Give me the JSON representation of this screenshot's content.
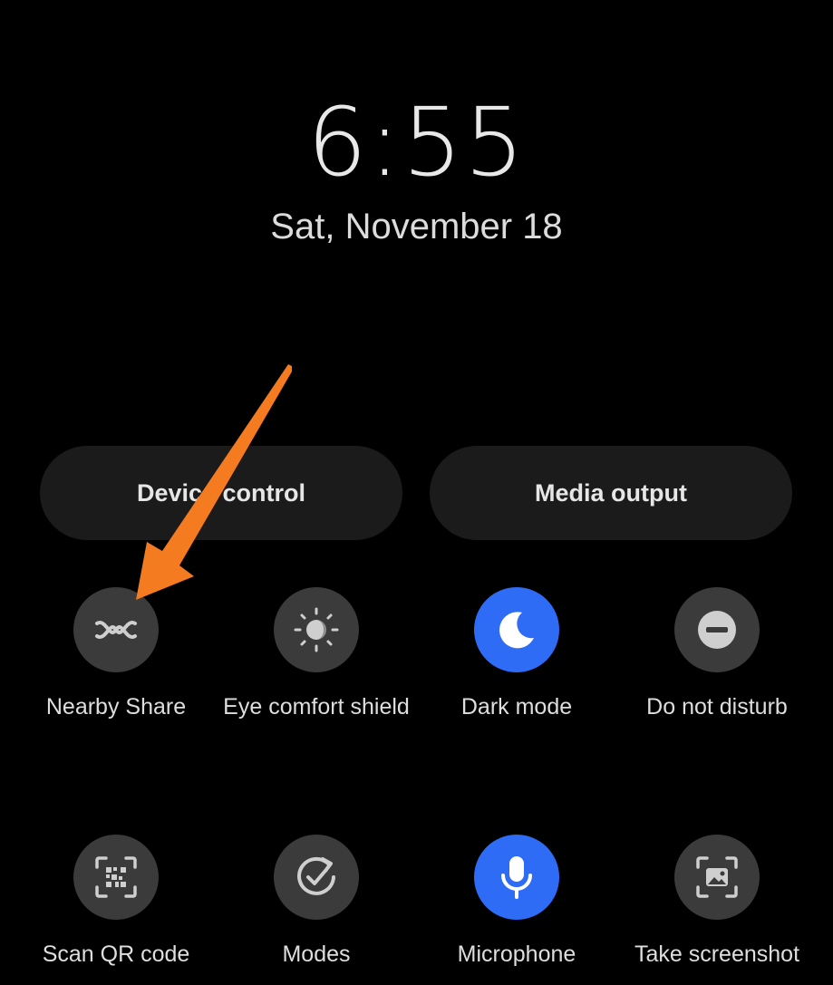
{
  "lockscreen": {
    "time": "6:55",
    "date": "Sat, November 18"
  },
  "buttons": {
    "device_control": "Device control",
    "media_output": "Media output"
  },
  "tiles": [
    {
      "label": "Nearby Share",
      "icon": "nearby-share-icon",
      "active": false
    },
    {
      "label": "Eye comfort shield",
      "icon": "eye-comfort-icon",
      "active": false
    },
    {
      "label": "Dark mode",
      "icon": "moon-icon",
      "active": true
    },
    {
      "label": "Do not disturb",
      "icon": "do-not-disturb-icon",
      "active": false
    },
    {
      "label": "Scan QR code",
      "icon": "qr-code-icon",
      "active": false
    },
    {
      "label": "Modes",
      "icon": "modes-icon",
      "active": false
    },
    {
      "label": "Microphone",
      "icon": "microphone-icon",
      "active": true
    },
    {
      "label": "Take screenshot",
      "icon": "screenshot-icon",
      "active": false
    }
  ],
  "colors": {
    "background": "#000000",
    "pill": "#1b1b1b",
    "tile_inactive": "#3b3b3b",
    "tile_active": "#2f6cf5",
    "annotation_arrow": "#f47b20"
  }
}
